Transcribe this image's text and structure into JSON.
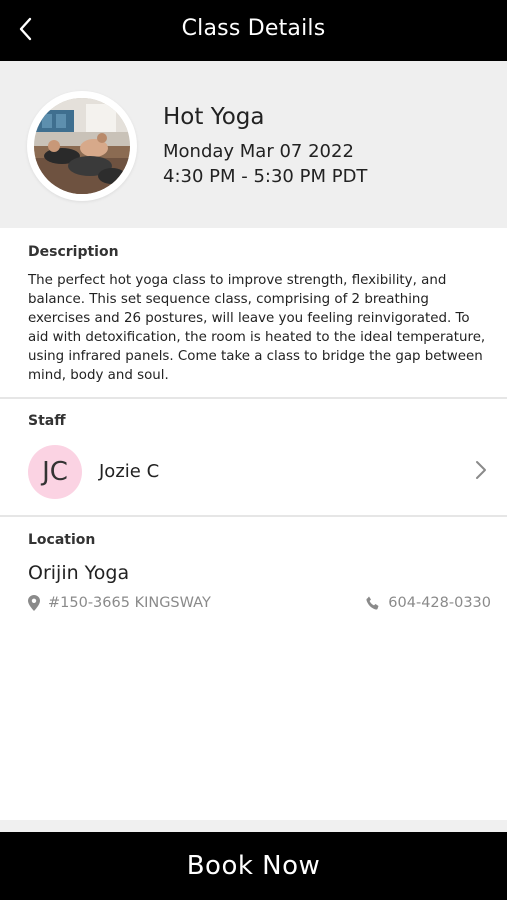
{
  "header": {
    "title": "Class Details",
    "back_icon": "chevron-left-icon"
  },
  "class": {
    "name": "Hot Yoga",
    "date": "Monday Mar 07 2022",
    "time": "4:30 PM - 5:30 PM PDT",
    "photo": "class-photo"
  },
  "description": {
    "label": "Description",
    "text": "The perfect hot yoga class to improve strength, flexibility, and balance. This set sequence class, comprising of 2 breathing exercises and 26 postures, will leave you feeling reinvigorated. To aid with detoxification, the room is heated to the ideal temperature, using infrared panels. Come take a class to bridge the gap between mind, body and soul."
  },
  "staff": {
    "label": "Staff",
    "initials": "JC",
    "name": "Jozie C",
    "avatar_color": "#fbd3e3",
    "chevron_icon": "chevron-right-icon"
  },
  "location": {
    "label": "Location",
    "name": "Orijin Yoga",
    "address": "#150-3665 KINGSWAY",
    "phone": "604-428-0330",
    "address_icon": "map-pin-icon",
    "phone_icon": "phone-icon"
  },
  "footer": {
    "book_label": "Book Now"
  },
  "colors": {
    "header_bg": "#000000",
    "hero_bg": "#efefef",
    "muted_text": "#8a8a8a"
  }
}
